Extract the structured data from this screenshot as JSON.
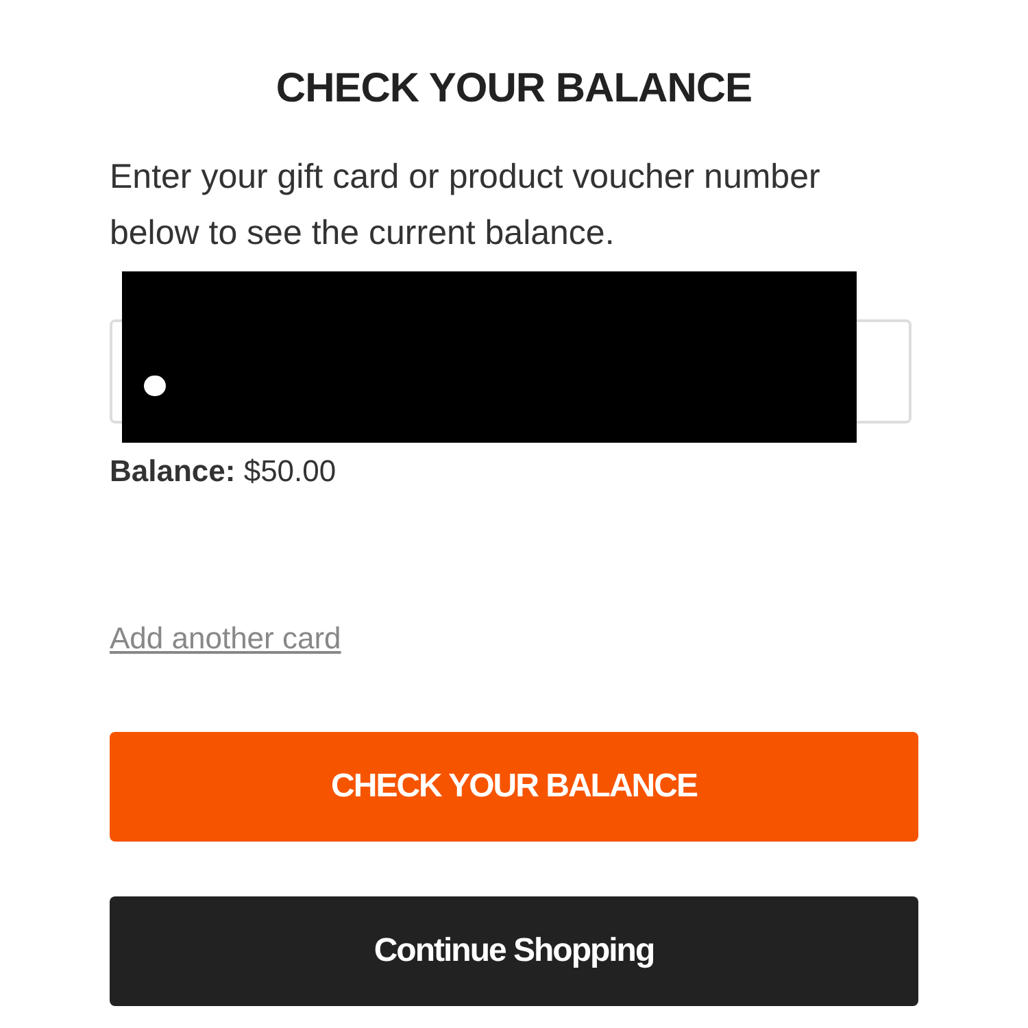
{
  "title": "CHECK YOUR BALANCE",
  "instructions": "Enter your gift card or product voucher number below to see the current balance.",
  "balance": {
    "label": "Balance:",
    "amount": "$50.00"
  },
  "add_card_link": "Add another card",
  "buttons": [
    {
      "label": "CHECK YOUR BALANCE",
      "kind": "primary"
    },
    {
      "label": "Continue Shopping",
      "kind": "secondary"
    }
  ]
}
